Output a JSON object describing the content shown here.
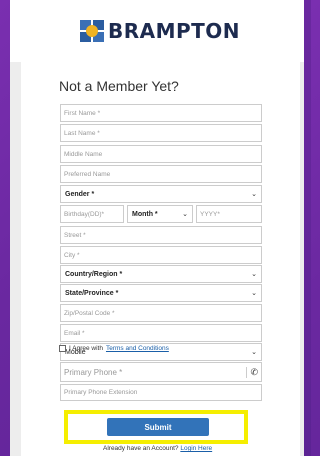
{
  "brand": {
    "name": "BRAMPTON"
  },
  "form": {
    "title": "Not a Member Yet?",
    "first_name_placeholder": "First Name *",
    "last_name_placeholder": "Last Name *",
    "middle_name_placeholder": "Middle Name",
    "preferred_name_placeholder": "Preferred Name",
    "gender_selected": "Gender *",
    "birthday_day_placeholder": "Birthday(DD)*",
    "month_selected": "Month *",
    "year_placeholder": "YYYY*",
    "street_placeholder": "Street *",
    "city_placeholder": "City *",
    "country_selected": "Country/Region *",
    "state_selected": "State/Province *",
    "zip_placeholder": "Zip/Postal Code *",
    "email_placeholder": "Email *",
    "phone_type_selected": "Mobile",
    "primary_phone_placeholder": "Primary Phone *",
    "phone_extension_placeholder": "Primary Phone Extension",
    "agree_text": "I Agree with",
    "terms_link": "Terms and Conditions",
    "submit_label": "Submit",
    "already_text": "Already have an Account?",
    "login_link": "Login Here"
  },
  "colors": {
    "brand_purple": "#6a28a0",
    "submit_blue": "#3273b9",
    "highlight_yellow": "#f5ee00"
  }
}
